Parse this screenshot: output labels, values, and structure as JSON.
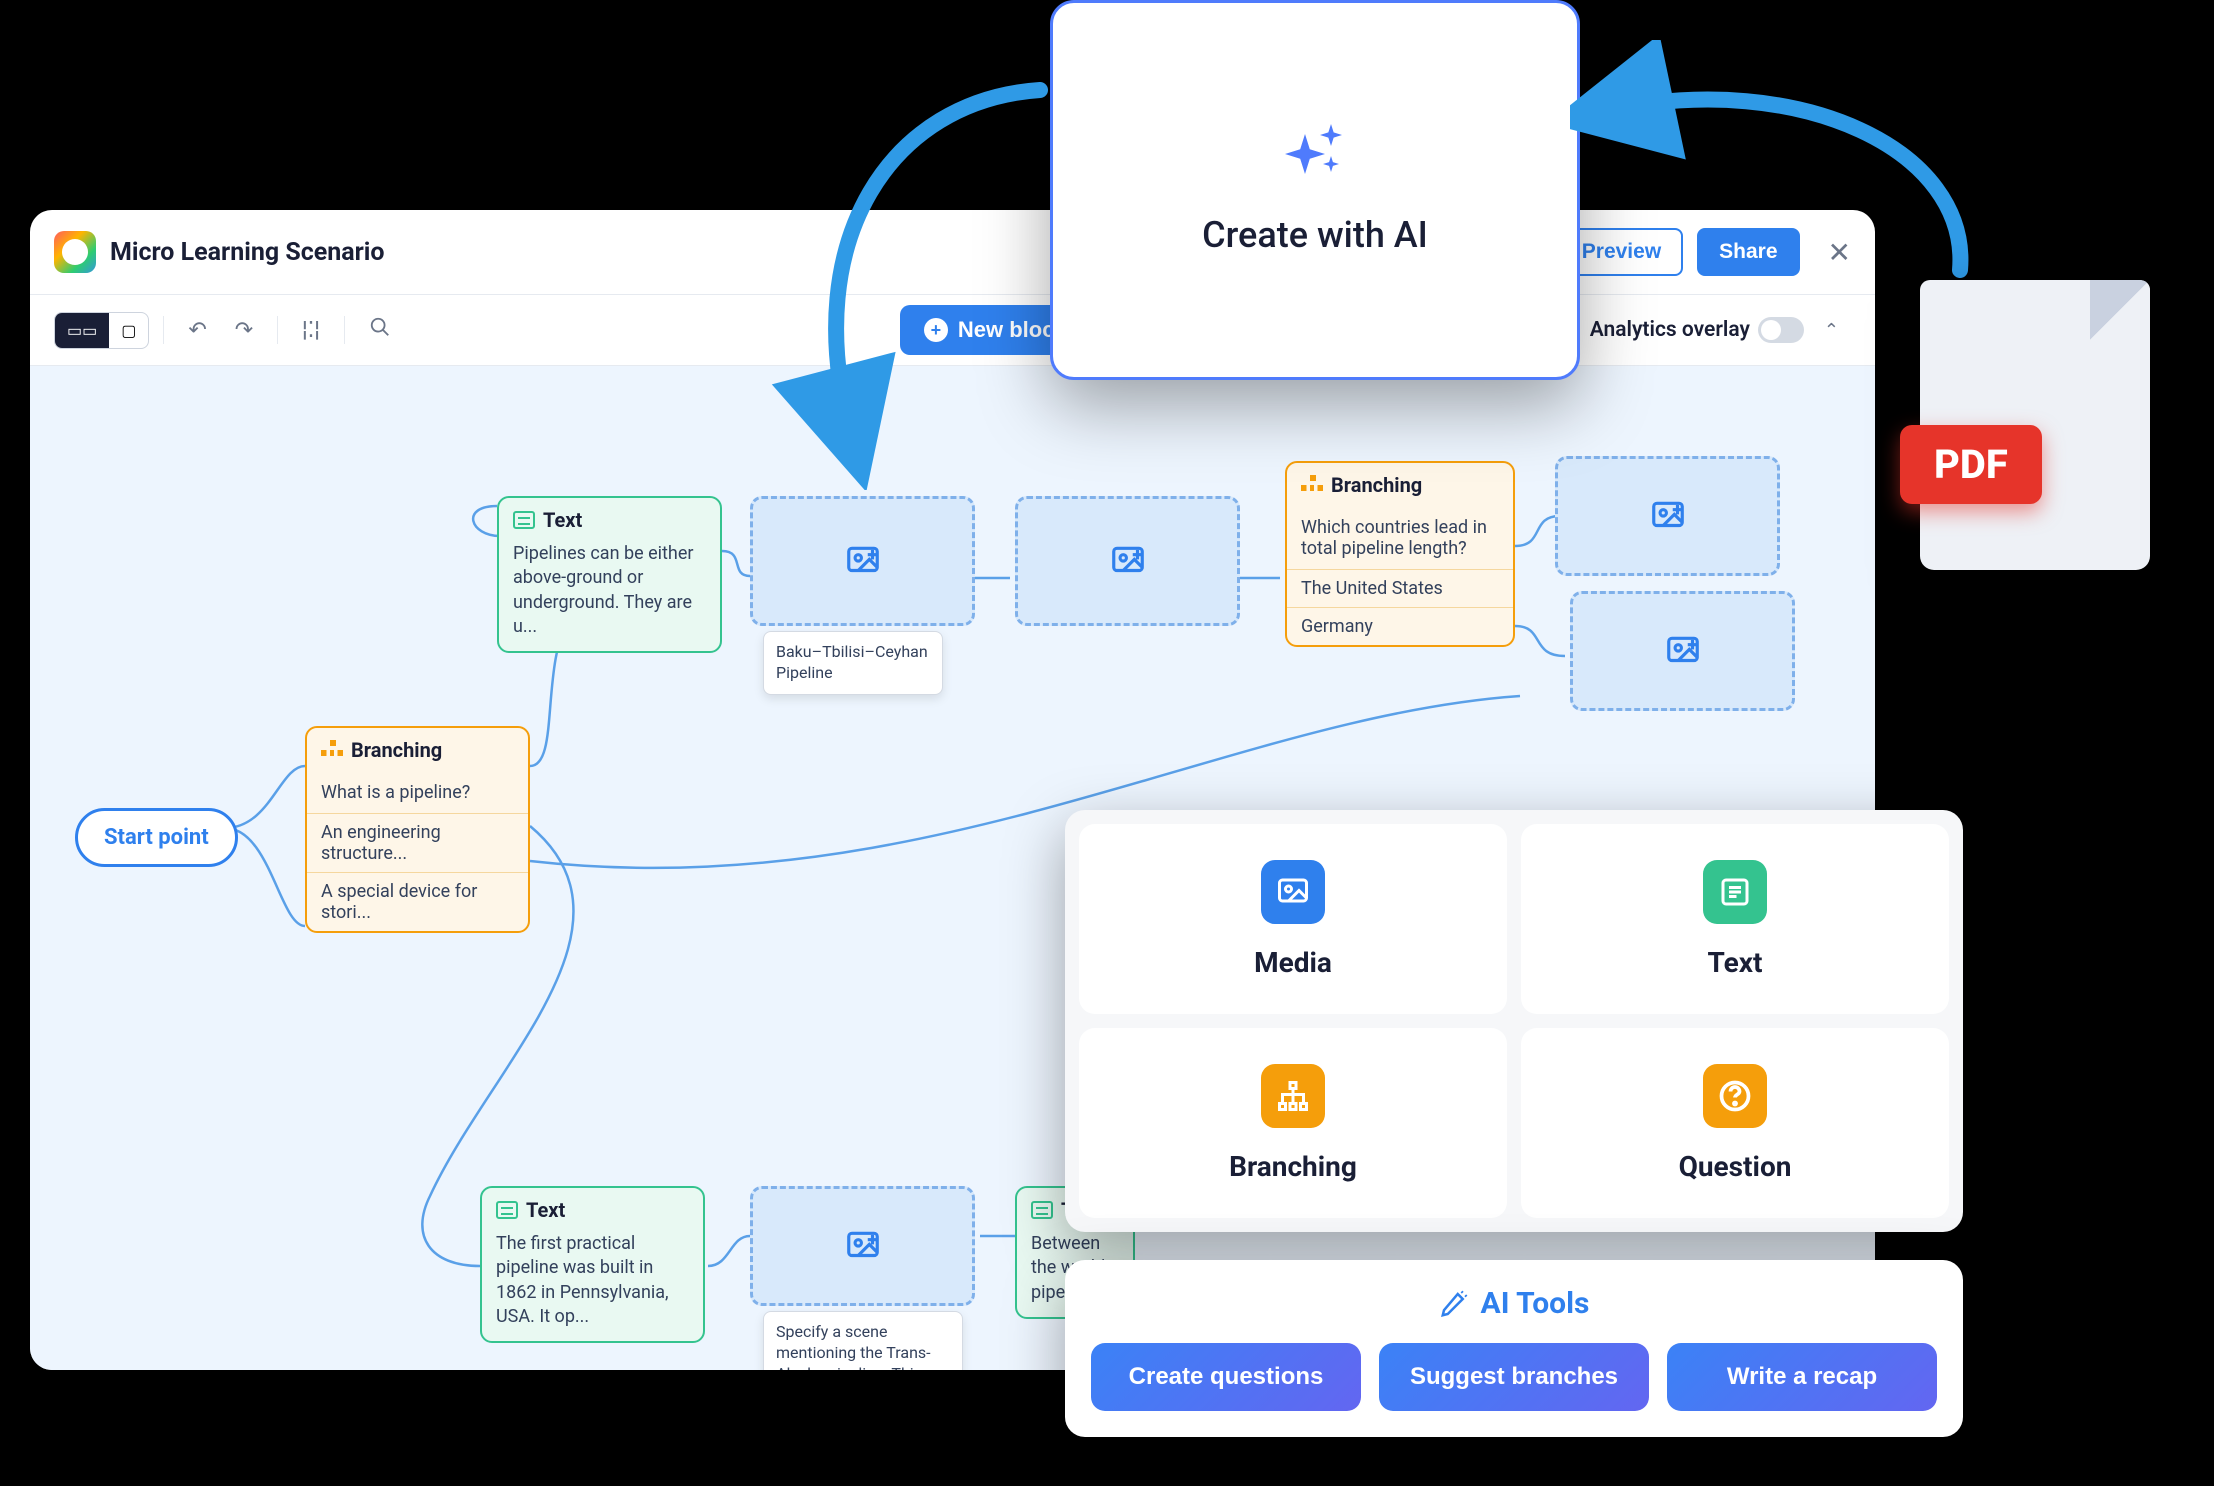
{
  "header": {
    "title": "Micro Learning Scenario",
    "preview": "Preview",
    "share": "Share"
  },
  "toolbar": {
    "new_block": "New block",
    "analytics_label": "Analytics overlay"
  },
  "canvas": {
    "start_point": "Start point",
    "text1": {
      "label": "Text",
      "body": "Pipelines can be either above-ground or underground. They are u..."
    },
    "text2": {
      "label": "Text",
      "body": "The first practical pipeline was built in 1862 in Pennsylvania, USA. It op..."
    },
    "text3": {
      "label": "Text",
      "body": "Between the world pipeline..."
    },
    "branch1": {
      "label": "Branching",
      "question": "What is a pipeline?",
      "opt1": "An engineering structure...",
      "opt2": "A special device for stori..."
    },
    "branch2": {
      "label": "Branching",
      "question": "Which countries lead in total pipeline length?",
      "opt1": "The United States",
      "opt2": "Germany"
    },
    "tooltip1": "Baku–Tbilisi–Ceyhan Pipeline",
    "tooltip2": "Specify a scene mentioning the Trans-Alaska pipeline. This section is about the c..."
  },
  "ai_card": {
    "label": "Create with AI"
  },
  "tools": {
    "media": "Media",
    "text": "Text",
    "branching": "Branching",
    "question": "Question"
  },
  "ai_tools": {
    "title": "AI Tools",
    "create_questions": "Create questions",
    "suggest_branches": "Suggest branches",
    "write_recap": "Write a recap"
  },
  "pdf": {
    "label": "PDF"
  }
}
